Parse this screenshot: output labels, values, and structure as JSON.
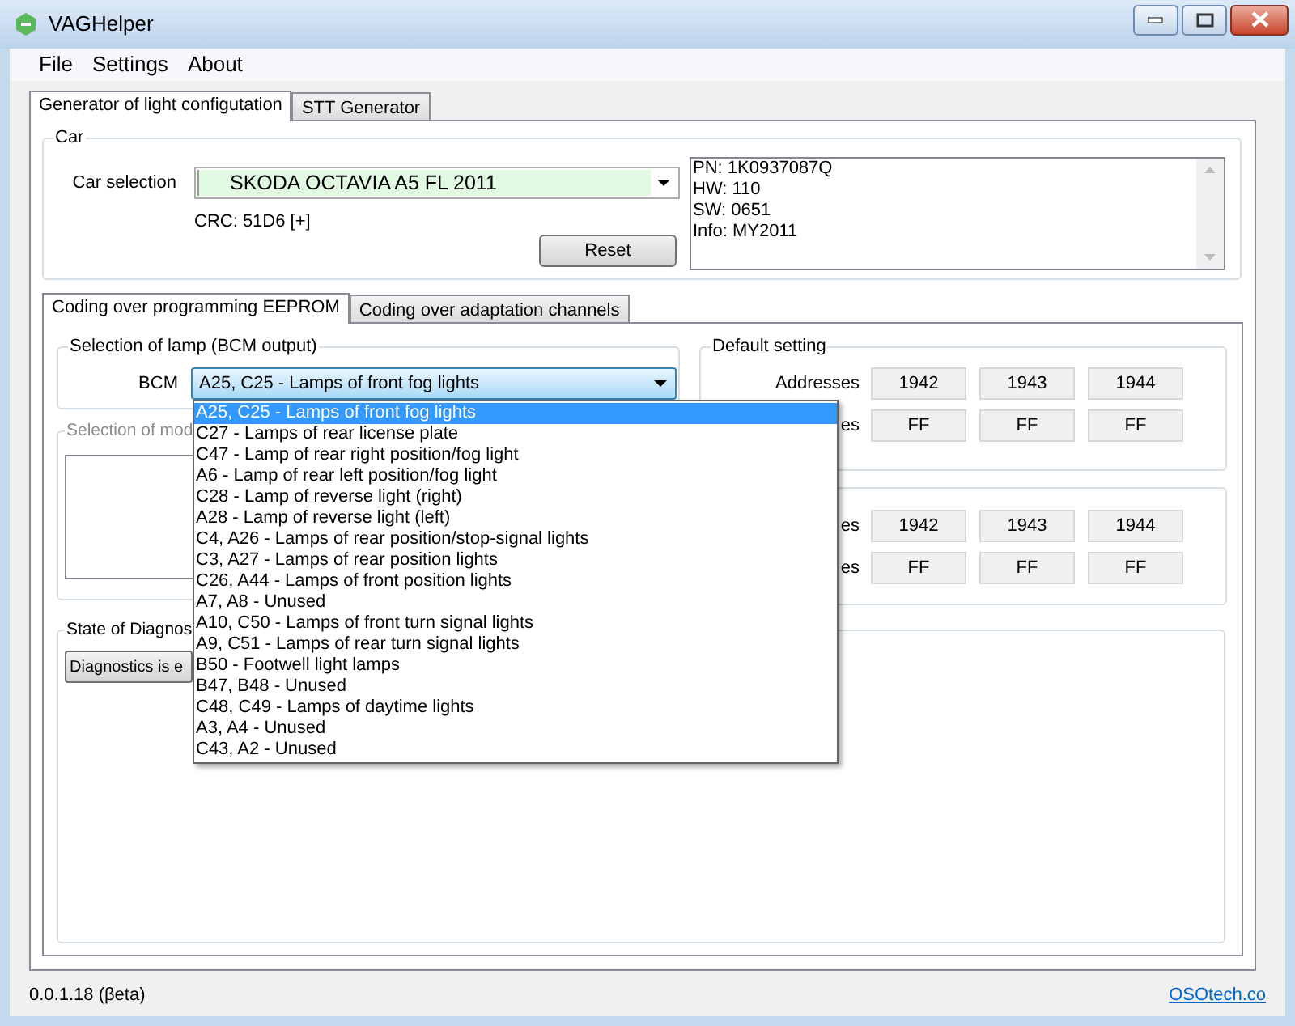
{
  "window": {
    "title": "VAGHelper"
  },
  "menu": [
    "File",
    "Settings",
    "About"
  ],
  "tabs": [
    {
      "label": "Generator of light configutation",
      "selected": true
    },
    {
      "label": "STT Generator",
      "selected": false
    }
  ],
  "car_group": {
    "title": "Car",
    "car_selection_label": "Car selection",
    "car_selection_value": "SKODA OCTAVIA A5 FL 2011",
    "crc": "CRC: 51D6 [+]",
    "reset_button": "Reset",
    "info_lines": [
      "PN: 1K0937087Q",
      "HW: 110",
      "SW: 0651",
      "Info: MY2011"
    ]
  },
  "coding_tabs": [
    {
      "label": "Coding over programming EEPROM",
      "selected": true
    },
    {
      "label": "Coding over adaptation channels",
      "selected": false
    }
  ],
  "lamp_group": {
    "title": "Selection of lamp (BCM output)",
    "bcm_label": "BCM",
    "bcm_value": "A25, C25 - Lamps of front fog lights",
    "options": [
      {
        "label": "A25, C25 - Lamps of front fog lights",
        "selected": true
      },
      {
        "label": "C27 - Lamps of rear license plate",
        "selected": false
      },
      {
        "label": "C47 - Lamp of rear right position/fog light",
        "selected": false
      },
      {
        "label": "A6 - Lamp of rear left position/fog light",
        "selected": false
      },
      {
        "label": "C28 - Lamp of reverse light (right)",
        "selected": false
      },
      {
        "label": "A28 - Lamp of reverse light (left)",
        "selected": false
      },
      {
        "label": "C4, A26 - Lamps of rear position/stop-signal lights",
        "selected": false
      },
      {
        "label": "C3, A27 - Lamps of rear position lights",
        "selected": false
      },
      {
        "label": "C26, A44 - Lamps of front position lights",
        "selected": false
      },
      {
        "label": "A7, A8 - Unused",
        "selected": false
      },
      {
        "label": "A10, C50 - Lamps of front turn signal lights",
        "selected": false
      },
      {
        "label": "A9, C51 - Lamps of rear turn signal lights",
        "selected": false
      },
      {
        "label": "B50 - Footwell light lamps",
        "selected": false
      },
      {
        "label": "B47, B48 - Unused",
        "selected": false
      },
      {
        "label": "C48, C49 - Lamps of daytime lights",
        "selected": false
      },
      {
        "label": "A3, A4 - Unused",
        "selected": false
      },
      {
        "label": "C43, A2 - Unused",
        "selected": false
      }
    ]
  },
  "mode_group": {
    "title": "Selection of mod",
    "disabled": true
  },
  "default_group": {
    "title": "Default setting",
    "rows": [
      {
        "label": "Addresses",
        "cells": [
          "1942",
          "1943",
          "1944"
        ]
      },
      {
        "label": "es",
        "cells": [
          "FF",
          "FF",
          "FF"
        ]
      }
    ]
  },
  "second_group": {
    "rows": [
      {
        "label": "es",
        "cells": [
          "1942",
          "1943",
          "1944"
        ]
      },
      {
        "label": "es",
        "cells": [
          "FF",
          "FF",
          "FF"
        ]
      }
    ]
  },
  "diagnostics_group": {
    "title": "State of Diagnos",
    "button": "Diagnostics is e"
  },
  "status_bar": {
    "version": "0.0.1.18 (βeta)",
    "link": "OSOtech.co"
  }
}
